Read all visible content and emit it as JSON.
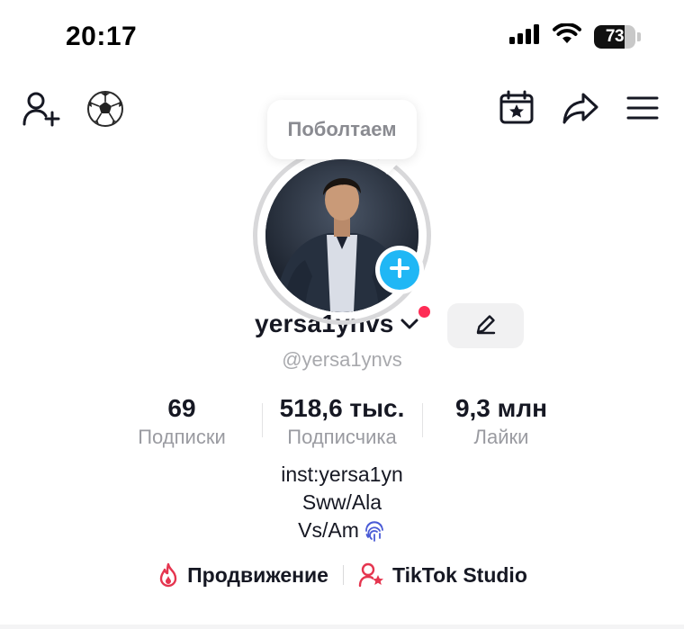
{
  "status_bar": {
    "time": "20:17",
    "battery_level": "73",
    "battery_fraction": 0.73,
    "icons": [
      "signal-icon",
      "wifi-icon",
      "battery-icon"
    ]
  },
  "nav": {
    "left_icons": [
      "add-friend-icon",
      "soccer-ball-icon"
    ],
    "right_icons": [
      "calendar-star-icon",
      "share-icon",
      "menu-icon"
    ]
  },
  "tooltip": {
    "text": "Поболтаем"
  },
  "profile": {
    "display_name": "yersa1ynvs",
    "handle": "@yersa1ynvs"
  },
  "stats": [
    {
      "value": "69",
      "label": "Подписки"
    },
    {
      "value": "518,6 тыс.",
      "label": "Подписчика"
    },
    {
      "value": "9,3 млн",
      "label": "Лайки"
    }
  ],
  "bio": {
    "lines": [
      "inst:yersa1yn",
      "Sww/Ala",
      "Vs/Am"
    ],
    "emoji_icon": "fingerprint-icon"
  },
  "links": [
    {
      "label": "Продвижение",
      "icon": "flame-icon"
    },
    {
      "label": "TikTok Studio",
      "icon": "creator-star-icon"
    }
  ],
  "colors": {
    "accent_red": "#fe2c55",
    "add_blue": "#20b7f5",
    "secondary_text": "#9a9ba1"
  }
}
